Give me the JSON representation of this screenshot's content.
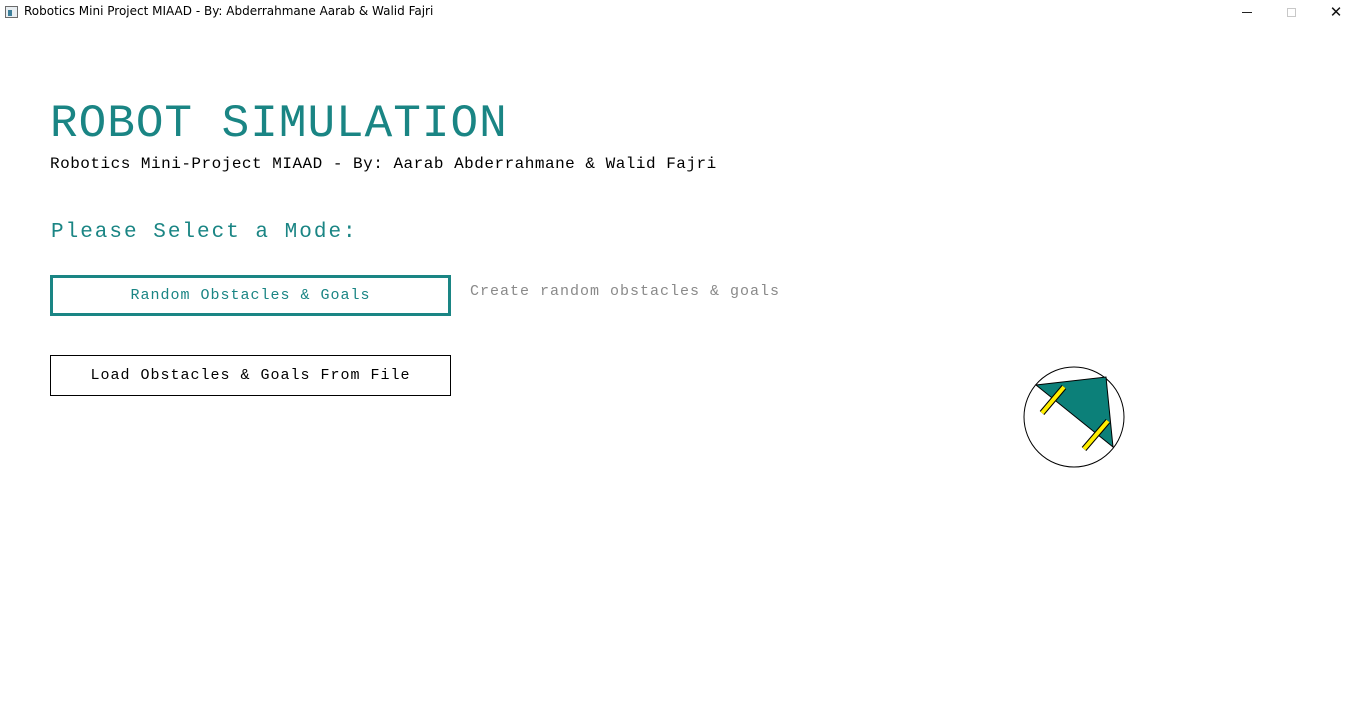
{
  "window": {
    "title": "Robotics Mini Project MIAAD - By: Abderrahmane Aarab & Walid Fajri",
    "minimize_icon": "minimize-icon",
    "maximize_icon": "maximize-icon",
    "close_icon": "close-icon",
    "close_glyph": "✕"
  },
  "main": {
    "title": "ROBOT SIMULATION",
    "subtitle": "Robotics Mini-Project MIAAD - By: Aarab Abderrahmane & Walid Fajri",
    "prompt": "Please Select a Mode:",
    "modes": [
      {
        "label": "Random Obstacles & Goals",
        "hint": "Create random obstacles & goals",
        "selected": true
      },
      {
        "label": "Load Obstacles & Goals From File",
        "selected": false
      }
    ]
  },
  "robot": {
    "icon": "robot-icon",
    "body_color": "#0c8079",
    "wheel_color": "#ffee00",
    "outline_color": "#000000"
  },
  "colors": {
    "accent": "#1a8584",
    "hint_text": "#8a8a8a"
  }
}
